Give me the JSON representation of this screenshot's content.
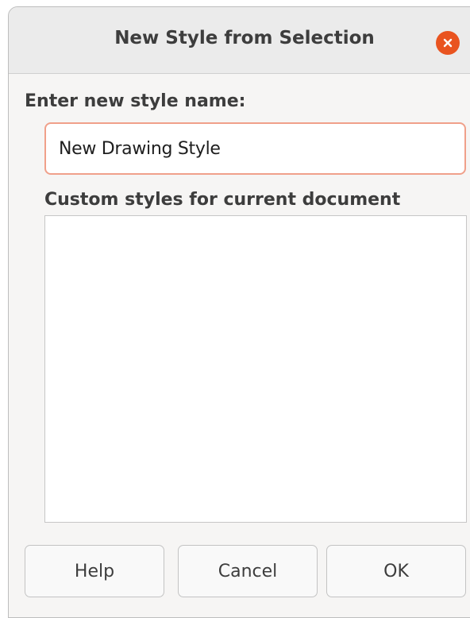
{
  "dialog": {
    "title": "New Style from Selection",
    "close_icon": "close-icon",
    "close_color": "#e95420"
  },
  "form": {
    "name_label": "Enter new style name:",
    "name_value": "New Drawing Style",
    "input_border_color": "#f0a08a",
    "styles_label": "Custom styles for current document",
    "custom_styles": []
  },
  "buttons": {
    "help": "Help",
    "cancel": "Cancel",
    "ok": "OK"
  }
}
